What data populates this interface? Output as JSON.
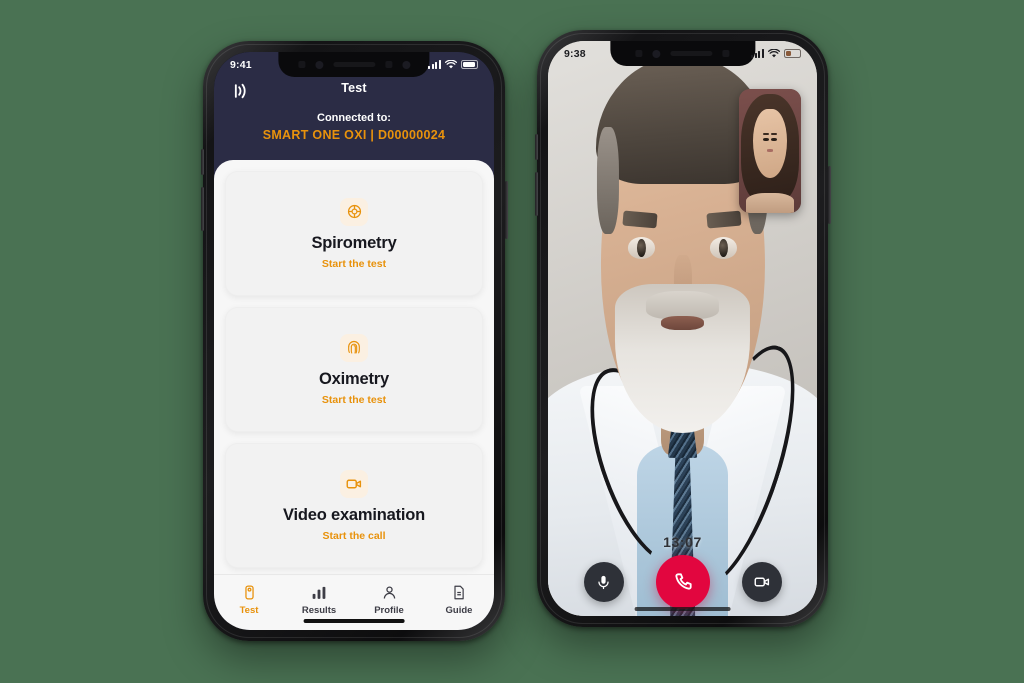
{
  "background_color": "#4a7253",
  "accent_color": "#E8920C",
  "header_color": "#2b2c45",
  "end_call_color": "#e2063f",
  "left_phone": {
    "status_bar": {
      "time": "9:41",
      "signal_icon": "cellular-bars-icon",
      "wifi_icon": "wifi-icon",
      "battery_icon": "battery-icon"
    },
    "header": {
      "wireless_icon": "wireless-signal-icon",
      "title": "Test",
      "connected_label": "Connected to:",
      "device_name": "SMART ONE OXI | D00000024"
    },
    "cards": [
      {
        "icon": "spirometry-target-icon",
        "title": "Spirometry",
        "action": "Start the test"
      },
      {
        "icon": "oximetry-fingerprint-icon",
        "title": "Oximetry",
        "action": "Start the test"
      },
      {
        "icon": "video-camera-icon",
        "title": "Video examination",
        "action": "Start the call"
      }
    ],
    "tabs": [
      {
        "icon": "device-test-icon",
        "label": "Test",
        "active": true
      },
      {
        "icon": "bar-chart-icon",
        "label": "Results",
        "active": false
      },
      {
        "icon": "person-icon",
        "label": "Profile",
        "active": false
      },
      {
        "icon": "document-icon",
        "label": "Guide",
        "active": false
      }
    ]
  },
  "right_phone": {
    "status_bar": {
      "time": "9:38",
      "signal_icon": "cellular-bars-icon",
      "wifi_icon": "wifi-icon",
      "battery_icon": "battery-icon"
    },
    "call": {
      "remote_participant": "doctor-video-feed",
      "self_view": "self-video-feed",
      "duration": "13:07",
      "controls": [
        {
          "icon": "microphone-icon",
          "name": "mute-button"
        },
        {
          "icon": "phone-hangup-icon",
          "name": "end-call-button"
        },
        {
          "icon": "video-camera-icon",
          "name": "toggle-camera-button"
        }
      ]
    }
  }
}
